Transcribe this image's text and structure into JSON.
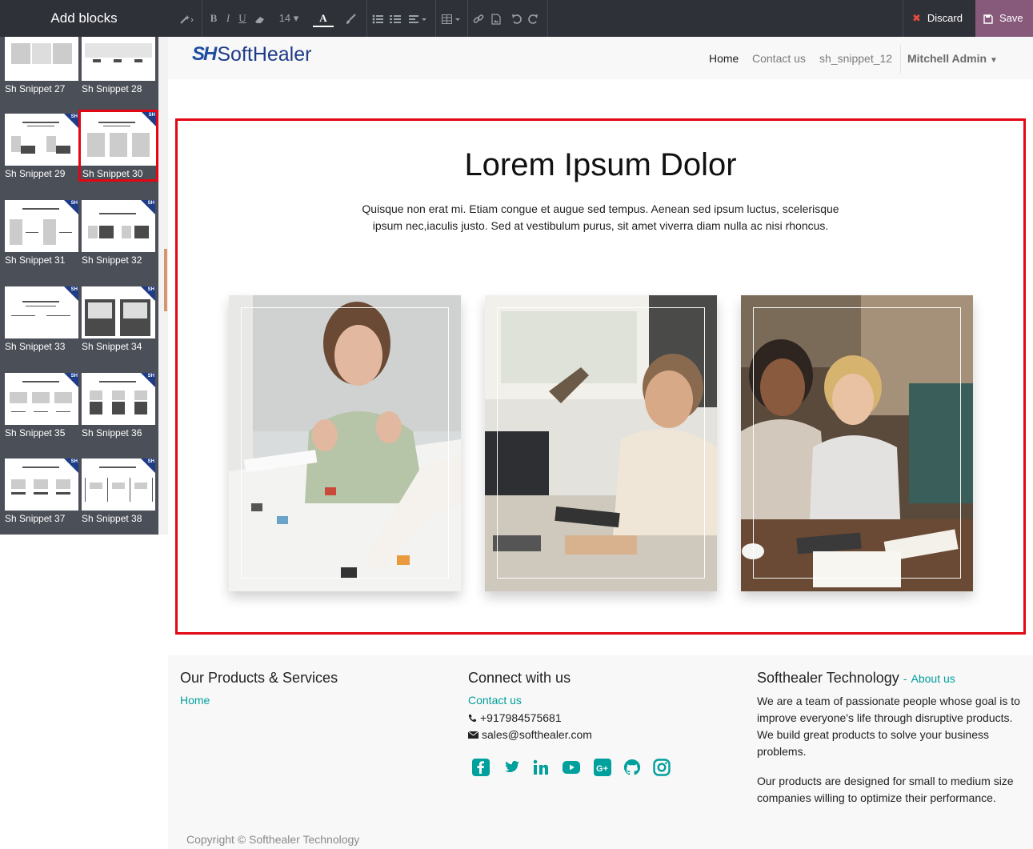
{
  "left_panel": {
    "title": "Add blocks",
    "snippets": [
      {
        "label": "Sh Snippet 27"
      },
      {
        "label": "Sh Snippet 28"
      },
      {
        "label": "Sh Snippet 29"
      },
      {
        "label": "Sh Snippet 30",
        "selected": true
      },
      {
        "label": "Sh Snippet 31"
      },
      {
        "label": "Sh Snippet 32"
      },
      {
        "label": "Sh Snippet 33"
      },
      {
        "label": "Sh Snippet 34"
      },
      {
        "label": "Sh Snippet 35"
      },
      {
        "label": "Sh Snippet 36"
      },
      {
        "label": "Sh Snippet 37"
      },
      {
        "label": "Sh Snippet 38"
      }
    ],
    "badge_text": "SH"
  },
  "toolbar": {
    "font_size": "14",
    "discard_label": "Discard",
    "save_label": "Save",
    "save_color": "#875a7b"
  },
  "navbar": {
    "logo_mark": "SH",
    "logo_text": "SoftHealer",
    "links": [
      "Home",
      "Contact us",
      "sh_snippet_12"
    ],
    "user": "Mitchell Admin"
  },
  "snippet": {
    "title": "Lorem Ipsum Dolor",
    "text": "Quisque non erat mi. Etiam congue et augue sed tempus. Aenean sed ipsum luctus, scelerisque ipsum nec,iaculis justo. Sed at vestibulum purus, sit amet viverra diam nulla ac nisi rhoncus.",
    "highlight_color": "#e30613"
  },
  "footer": {
    "col1": {
      "heading": "Our Products & Services",
      "link": "Home"
    },
    "col2": {
      "heading": "Connect with us",
      "link": "Contact us",
      "phone": "+917984575681",
      "email": "sales@softhealer.com",
      "social": [
        "facebook-icon",
        "twitter-icon",
        "linkedin-icon",
        "youtube-icon",
        "google-plus-icon",
        "github-icon",
        "instagram-icon"
      ]
    },
    "col3": {
      "heading": "Softhealer Technology",
      "heading_sep": "-",
      "about_link": "About us",
      "p1": "We are a team of passionate people whose goal is to improve everyone's life through disruptive products. We build great products to solve your business problems.",
      "p2": "Our products are designed for small to medium size companies willing to optimize their performance."
    },
    "copyright": "Copyright © Softhealer Technology",
    "accent_color": "#00a09d"
  }
}
